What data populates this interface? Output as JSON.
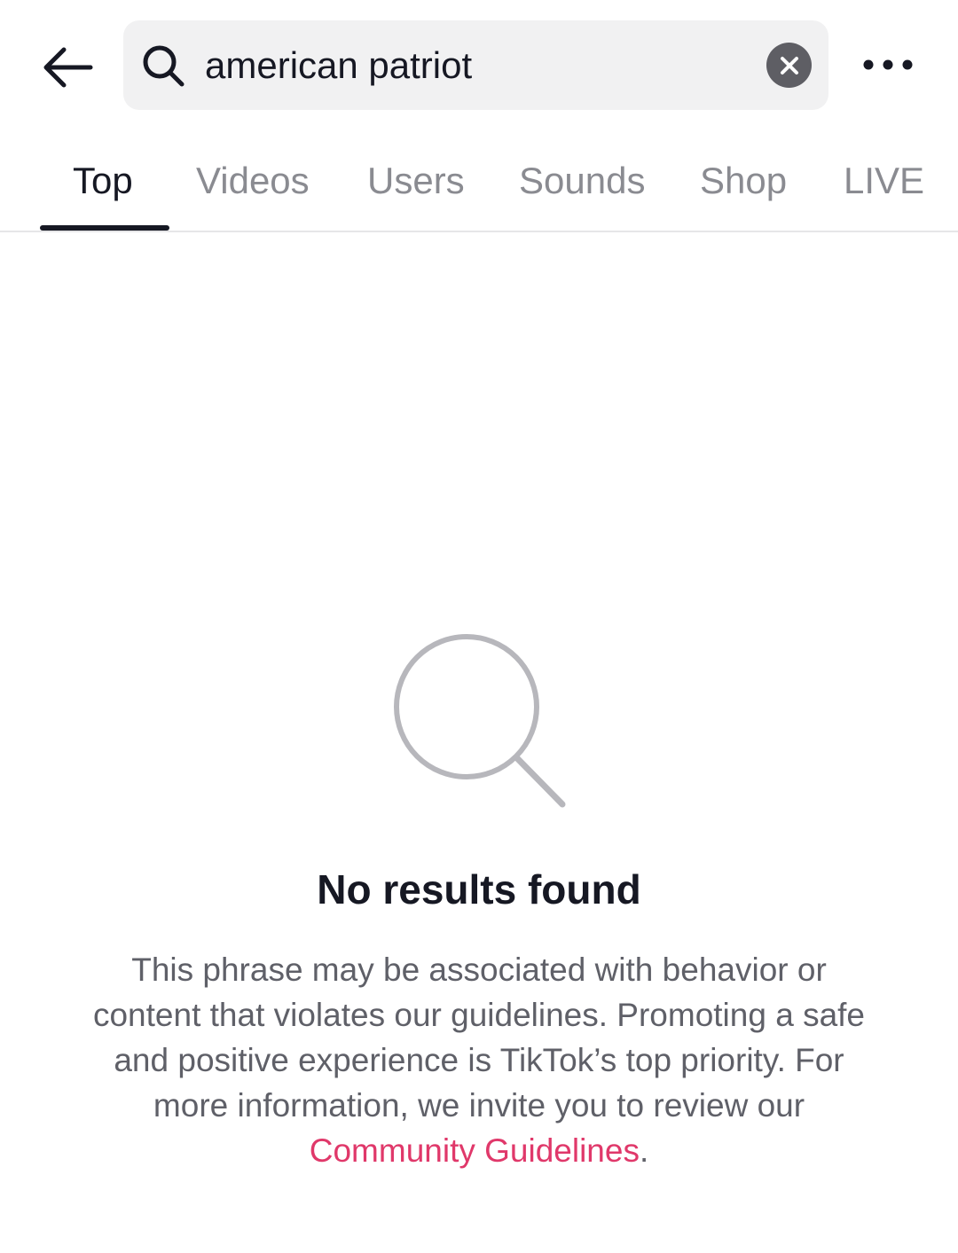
{
  "search": {
    "query": "american patriot"
  },
  "tabs": [
    {
      "label": "Top",
      "active": true
    },
    {
      "label": "Videos",
      "active": false
    },
    {
      "label": "Users",
      "active": false
    },
    {
      "label": "Sounds",
      "active": false
    },
    {
      "label": "Shop",
      "active": false
    },
    {
      "label": "LIVE",
      "active": false
    }
  ],
  "icons": {
    "back": "arrow-left-icon",
    "search": "search-icon",
    "clear": "close-circle-icon",
    "more": "more-horizontal-icon",
    "empty": "magnifier-icon"
  },
  "empty_state": {
    "title": "No results found",
    "body_text": "This phrase may be associated with behavior or content that violates our guidelines. Promoting a safe and positive experience is TikTok’s top priority. For more information, we invite you to review our ",
    "link_text": "Community Guidelines",
    "trailing_text": "."
  },
  "colors": {
    "text_primary": "#161823",
    "text_secondary": "#8a8b91",
    "link": "#e0386a",
    "search_bg": "#f1f1f2",
    "clear_button": "#5e5e64"
  }
}
